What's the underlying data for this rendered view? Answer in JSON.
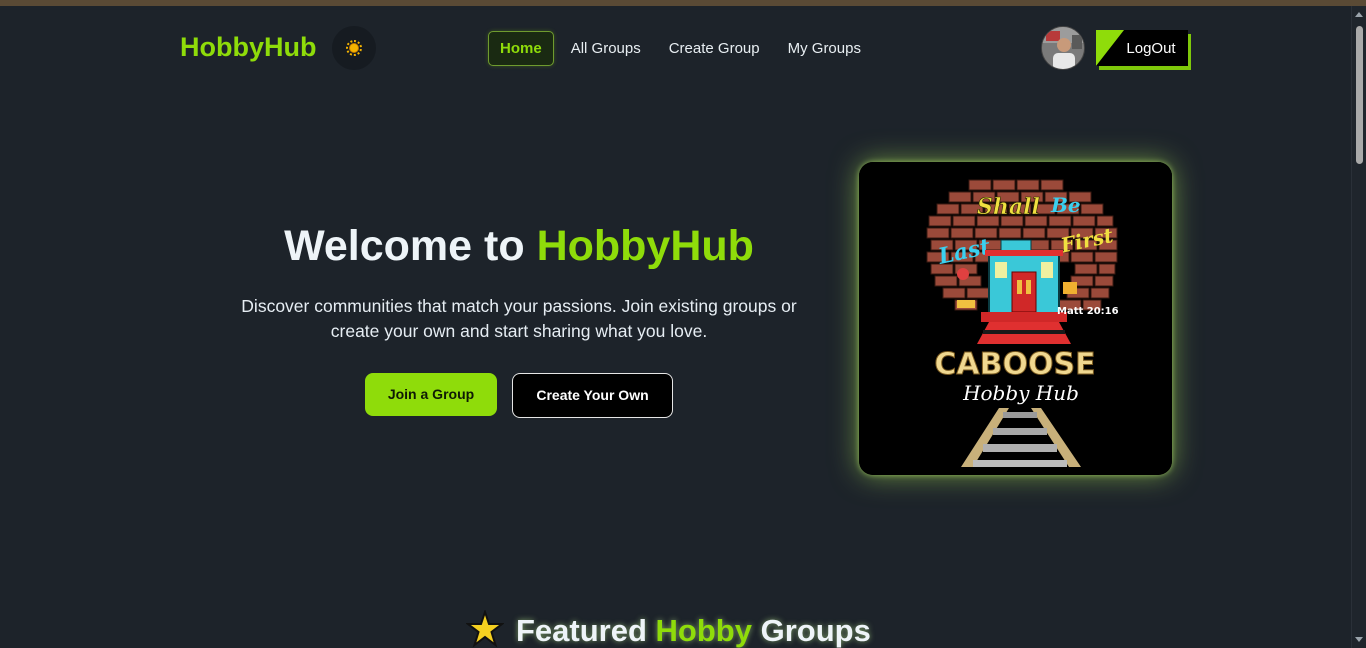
{
  "nav": {
    "brand": "HobbyHub",
    "theme_toggle_icon": "sun-icon",
    "links": [
      {
        "label": "Home",
        "active": true
      },
      {
        "label": "All Groups",
        "active": false
      },
      {
        "label": "Create Group",
        "active": false
      },
      {
        "label": "My Groups",
        "active": false
      }
    ],
    "avatar_icon": "user-avatar",
    "logout_label": "LogOut"
  },
  "hero": {
    "title_prefix": "Welcome to ",
    "title_accent": "HobbyHub",
    "subtitle": "Discover communities that match your passions. Join existing groups or create your own and start sharing what you love.",
    "primary_button": "Join a Group",
    "secondary_button": "Create Your Own",
    "image": {
      "word_shall": "Shall",
      "word_be": "Be",
      "word_last": "Last",
      "word_first": "First",
      "verse": "Matt 20:16",
      "caboose": "CABOOSE",
      "hobby_hub": "Hobby Hub"
    }
  },
  "featured": {
    "icon": "star-icon",
    "title_part1": "Featured ",
    "title_accent": "Hobby",
    "title_part2": " Groups"
  },
  "colors": {
    "background": "#1d232a",
    "accent": "#8fdc0a",
    "text": "#e6edf3"
  }
}
